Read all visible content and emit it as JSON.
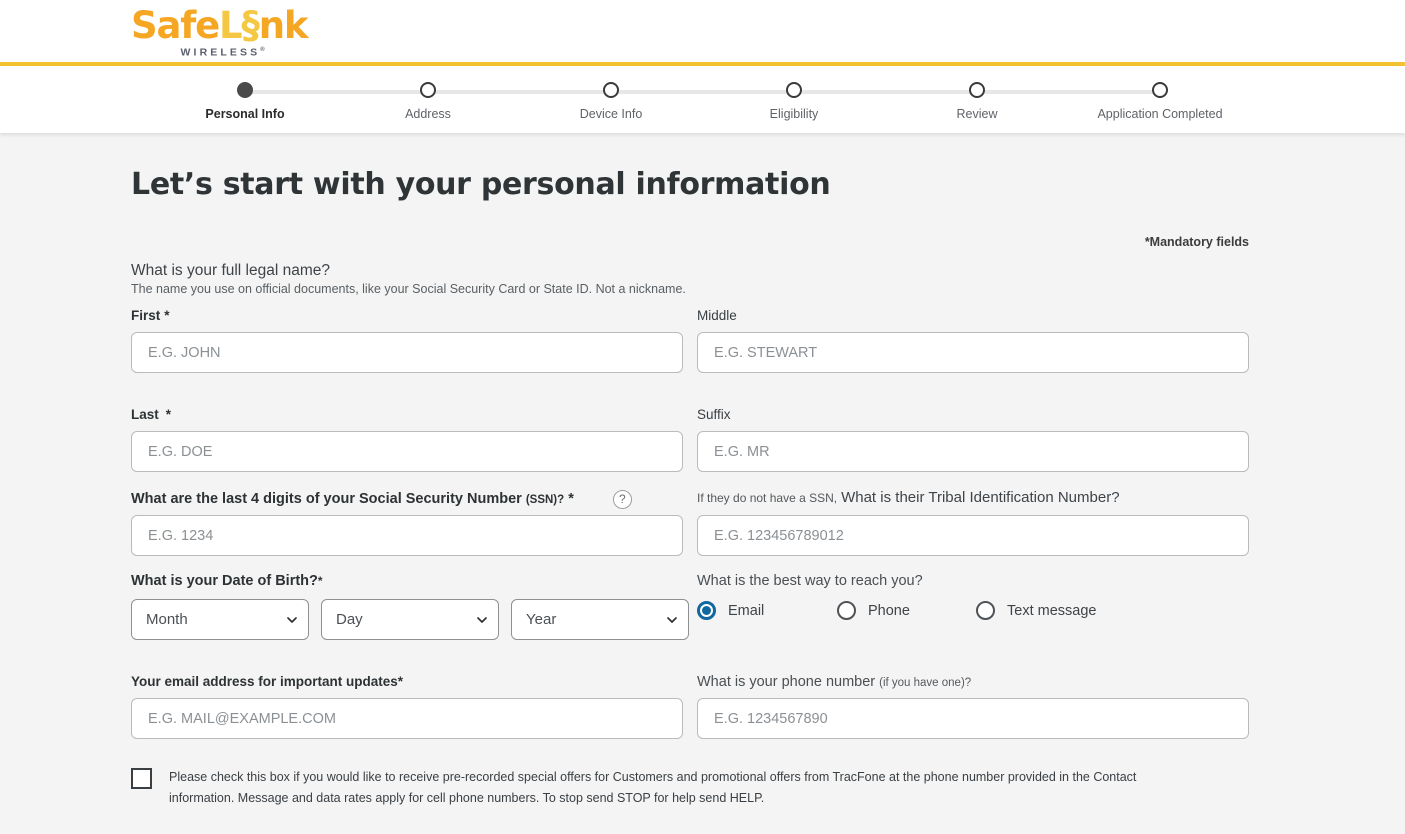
{
  "brand": {
    "logo_safe": "Safe",
    "logo_l": "L",
    "logo_i": "§",
    "logo_nk": "nk",
    "logo_sub": "WIRELESS",
    "accent_gold": "#F2C230",
    "accent_orange": "#F5A623",
    "accent_blue": "#11679F"
  },
  "stepper": {
    "steps": [
      {
        "label": "Personal Info",
        "state": "active"
      },
      {
        "label": "Address",
        "state": "pending"
      },
      {
        "label": "Device Info",
        "state": "pending"
      },
      {
        "label": "Eligibility",
        "state": "pending"
      },
      {
        "label": "Review",
        "state": "pending"
      },
      {
        "label": "Application Completed",
        "state": "pending"
      }
    ]
  },
  "page": {
    "title": "Let’s start with your personal information",
    "mandatory_note": "*Mandatory fields"
  },
  "name_section": {
    "question": "What is your full legal name?",
    "hint": "The name you use on official documents, like your Social Security Card or State ID. Not a nickname.",
    "first": {
      "label": "First",
      "required_mark": "*",
      "placeholder": "E.G. JOHN",
      "value": ""
    },
    "middle": {
      "label": "Middle",
      "required_mark": "",
      "placeholder": "E.G. STEWART",
      "value": ""
    },
    "last": {
      "label": "Last",
      "required_mark": "*",
      "placeholder": "E.G. DOE",
      "value": ""
    },
    "suffix": {
      "label": "Suffix",
      "required_mark": "",
      "placeholder": "E.G. MR",
      "value": ""
    }
  },
  "ssn_section": {
    "question_main": "What are the last 4 digits of your Social Security Number",
    "question_small": "(SSN)?",
    "required_mark": "*",
    "help_icon": "?",
    "placeholder": "E.G. 1234",
    "value": "",
    "tribal_prefix": "If they do not have a SSN,",
    "tribal_question": "What is their Tribal Identification Number?",
    "tribal_placeholder": "E.G. 123456789012",
    "tribal_value": ""
  },
  "dob_section": {
    "label": "What is your Date of Birth?",
    "required_mark": "*",
    "month": {
      "selected": "Month",
      "options": [
        "Month"
      ]
    },
    "day": {
      "selected": "Day",
      "options": [
        "Day"
      ]
    },
    "year": {
      "selected": "Year",
      "options": [
        "Year"
      ]
    }
  },
  "contact_method": {
    "question": "What is the best way to reach you?",
    "options": [
      {
        "label": "Email",
        "selected": true
      },
      {
        "label": "Phone",
        "selected": false
      },
      {
        "label": "Text message",
        "selected": false
      }
    ]
  },
  "contact_fields": {
    "email": {
      "label": "Your email address for important updates*",
      "placeholder": "E.G. MAIL@EXAMPLE.COM",
      "value": ""
    },
    "phone": {
      "label_main": "What is your phone number",
      "label_small": "(if you have one)?",
      "placeholder": "E.G. 1234567890",
      "value": ""
    }
  },
  "consent": {
    "checked": false,
    "text": "Please check this box if you would like to receive pre-recorded special offers for Customers and promotional offers from TracFone at the phone number provided in the Contact information. Message and data rates apply for cell phone numbers. To stop send STOP for help send HELP."
  }
}
